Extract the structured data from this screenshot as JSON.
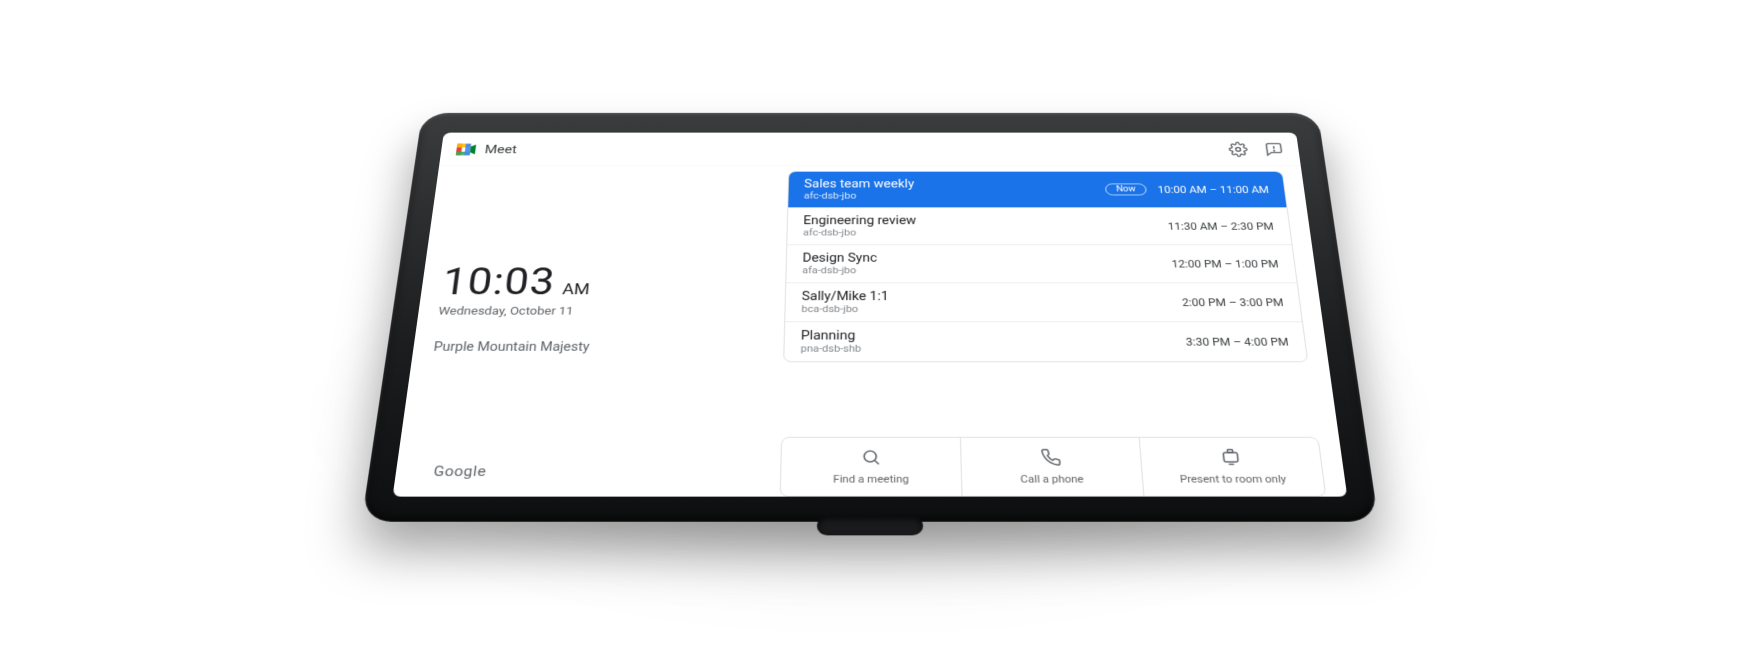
{
  "app": {
    "title": "Meet"
  },
  "clock": {
    "time": "10:03",
    "ampm": "AM",
    "date": "Wednesday, October 11"
  },
  "room": {
    "name": "Purple Mountain Majesty"
  },
  "meetings": [
    {
      "title": "Sales team weekly",
      "code": "afc-dsb-jbo",
      "time": "10:00 AM – 11:00 AM",
      "now": "Now",
      "active": true
    },
    {
      "title": "Engineering review",
      "code": "afc-dsb-jbo",
      "time": "11:30 AM – 2:30 PM"
    },
    {
      "title": "Design Sync",
      "code": "afa-dsb-jbo",
      "time": "12:00 PM – 1:00 PM"
    },
    {
      "title": "Sally/Mike 1:1",
      "code": "bca-dsb-jbo",
      "time": "2:00 PM – 3:00 PM"
    },
    {
      "title": "Planning",
      "code": "pna-dsb-shb",
      "time": "3:30 PM – 4:00 PM"
    }
  ],
  "actions": {
    "find": "Find a meeting",
    "call": "Call a phone",
    "present": "Present to room only"
  },
  "footer": {
    "brand": "Google"
  }
}
